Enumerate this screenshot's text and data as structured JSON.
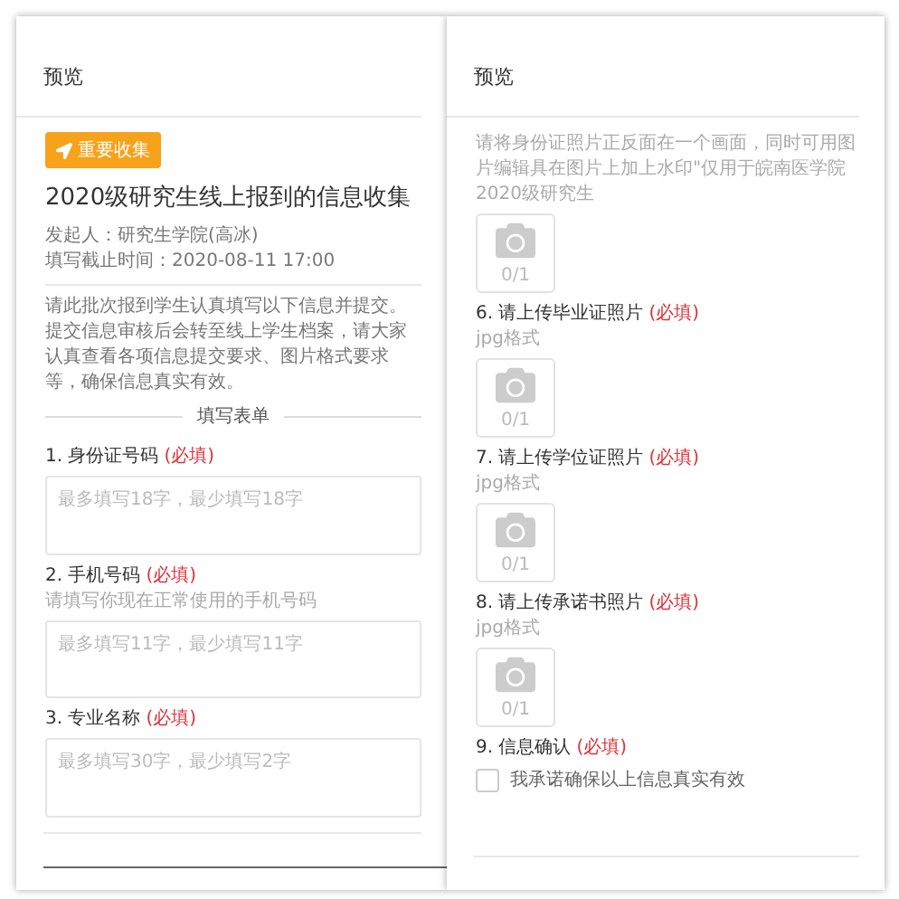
{
  "panels": [
    {
      "title": "预览",
      "tag": "重要收集",
      "form_title": "2020级研究生线上报到的信息收集",
      "meta": [
        "发起人：研究生学院(高冰)",
        "填写截止时间：2020-08-11 17:00"
      ],
      "intro": [
        "请此批次报到学生认真填写以下信息并提交。",
        "提交信息审核后会转至线上学生档案，请大家认真查看各项信息提交要求、图片格式要求等，确保信息真实有效。"
      ],
      "items": [
        {
          "kind": "section",
          "text": "填写表单"
        },
        {
          "kind": "label",
          "text": "1. 身份证号码",
          "required": "(必填)"
        },
        {
          "kind": "textarea",
          "placeholder": "最多填写18字，最少填写18字"
        },
        {
          "kind": "label",
          "text": "2. 手机号码",
          "required": "(必填)"
        },
        {
          "kind": "hint",
          "text": "请填写你现在正常使用的手机号码"
        },
        {
          "kind": "textarea",
          "placeholder": "最多填写11字，最少填写11字"
        },
        {
          "kind": "label",
          "text": "3. 专业名称",
          "required": "(必填)"
        },
        {
          "kind": "textarea",
          "placeholder": "最多填写30字，最少填写2字"
        }
      ]
    },
    {
      "title": "预览",
      "items": [
        {
          "kind": "hint",
          "text": "请将身份证照片正反面在一个画面，同时可用图片编辑具在图片上加上水印\"仅用于皖南医学院2020级研究生"
        },
        {
          "kind": "upload",
          "count": "0/1"
        },
        {
          "kind": "label",
          "text": "6. 请上传毕业证照片",
          "required": "(必填)"
        },
        {
          "kind": "hint",
          "text": "jpg格式"
        },
        {
          "kind": "upload",
          "count": "0/1"
        },
        {
          "kind": "label",
          "text": "7. 请上传学位证照片",
          "required": "(必填)"
        },
        {
          "kind": "hint",
          "text": "jpg格式"
        },
        {
          "kind": "upload",
          "count": "0/1"
        },
        {
          "kind": "label",
          "text": "8. 请上传承诺书照片",
          "required": "(必填)"
        },
        {
          "kind": "hint",
          "text": "jpg格式"
        },
        {
          "kind": "upload",
          "count": "0/1"
        },
        {
          "kind": "label",
          "text": "9. 信息确认",
          "required": "(必填)"
        },
        {
          "kind": "checkbox",
          "text": "我承诺确保以上信息真实有效",
          "checked": false
        }
      ]
    }
  ]
}
